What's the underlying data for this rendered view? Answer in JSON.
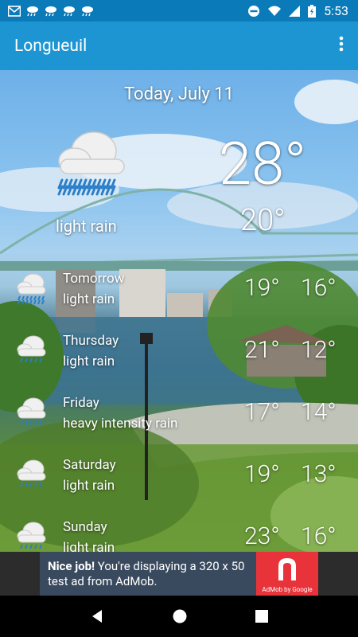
{
  "status_bar": {
    "time": "5:53",
    "left_icons": [
      "gmail-icon",
      "rain-icon",
      "rain-icon",
      "rain-icon",
      "rain-icon"
    ],
    "right_icons": [
      "do-not-disturb-icon",
      "wifi-icon",
      "signal-icon",
      "battery-icon"
    ]
  },
  "app_bar": {
    "title": "Longueuil",
    "menu_icon": "more-vert-icon"
  },
  "today": {
    "date": "Today, July 11",
    "high": "28°",
    "low": "20°",
    "condition": "light rain",
    "icon": "rain-cloud-icon"
  },
  "forecast": [
    {
      "day": "Tomorrow",
      "condition": "light rain",
      "high": "19°",
      "low": "16°",
      "icon": "rain-cloud-icon"
    },
    {
      "day": "Thursday",
      "condition": "light rain",
      "high": "21°",
      "low": "12°",
      "icon": "rain-cloud-icon"
    },
    {
      "day": "Friday",
      "condition": "heavy intensity rain",
      "high": "17°",
      "low": "14°",
      "icon": "rain-cloud-icon"
    },
    {
      "day": "Saturday",
      "condition": "light rain",
      "high": "19°",
      "low": "13°",
      "icon": "rain-cloud-icon"
    },
    {
      "day": "Sunday",
      "condition": "light rain",
      "high": "23°",
      "low": "16°",
      "icon": "rain-cloud-icon"
    }
  ],
  "ad": {
    "bold": "Nice job!",
    "text": " You're displaying a 320 x 50 test ad from AdMob.",
    "logo_label": "AdMob by Google"
  },
  "nav": {
    "back": "back-icon",
    "home": "home-icon",
    "recents": "recents-icon"
  }
}
